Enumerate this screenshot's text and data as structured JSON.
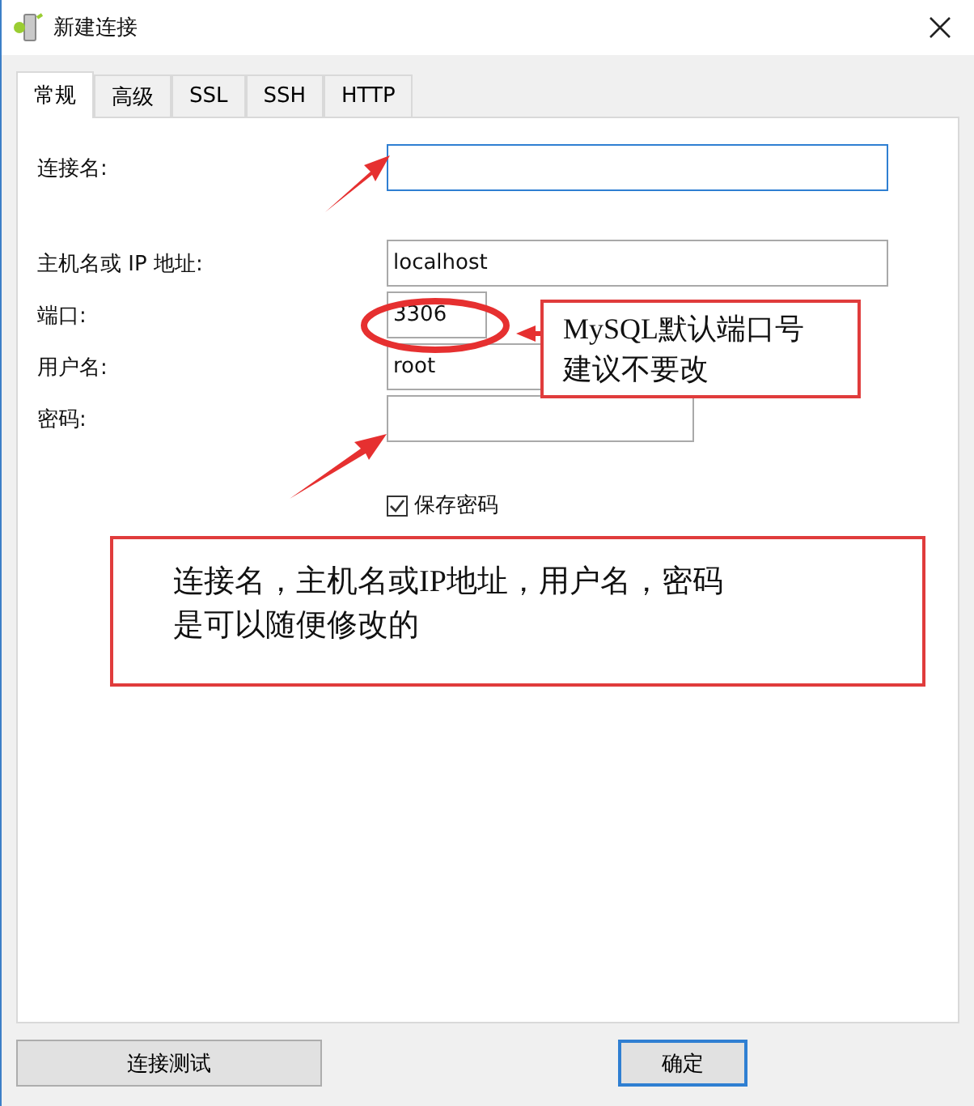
{
  "window": {
    "title": "新建连接"
  },
  "tabs": [
    {
      "label": "常规",
      "selected": true
    },
    {
      "label": "高级",
      "selected": false
    },
    {
      "label": "SSL",
      "selected": false
    },
    {
      "label": "SSH",
      "selected": false
    },
    {
      "label": "HTTP",
      "selected": false
    }
  ],
  "field_groups": [
    [
      {
        "label": "连接名:",
        "kind": "long",
        "focused": true
      }
    ],
    [
      {
        "label": "主机名或 IP 地址:",
        "value": "localhost",
        "kind": "long",
        "focused": false
      },
      {
        "label": "端口:",
        "value": "3306",
        "kind": "short",
        "focused": false
      },
      {
        "label": "用户名:",
        "value": "root",
        "kind": "medium",
        "focused": false
      },
      {
        "label": "密码:",
        "kind": "medium",
        "focused": false
      }
    ]
  ],
  "save_password": {
    "label": "保存密码",
    "checked": true
  },
  "notes": [
    {
      "kind": "port",
      "lines": [
        "MySQL默认端口号",
        "建议不要改"
      ]
    },
    {
      "kind": "general",
      "lines": [
        "连接名，主机名或IP地址，用户名，密码",
        "是可以随便修改的"
      ]
    }
  ],
  "buttons": [
    {
      "label": "连接测试",
      "kind": "test"
    },
    {
      "label": "确定",
      "kind": "ok"
    }
  ]
}
